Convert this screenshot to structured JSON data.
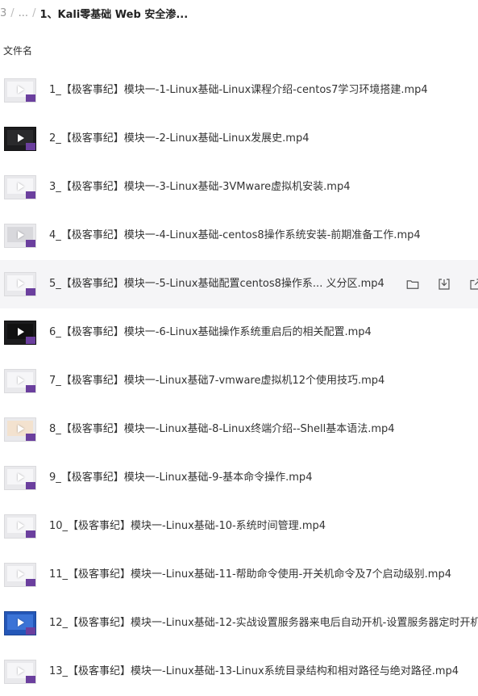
{
  "breadcrumb": {
    "prefix": "3",
    "ellipsis": "...",
    "current": "1、Kali零基础 Web 安全渗..."
  },
  "header": {
    "column_label": "文件名"
  },
  "files": [
    {
      "name": "1_【极客事纪】模块一-1-Linux基础-Linux课程介绍-centos7学习环境搭建.mp4",
      "thumb": "light"
    },
    {
      "name": "2_【极客事纪】模块一-2-Linux基础-Linux发展史.mp4",
      "thumb": "dark"
    },
    {
      "name": "3_【极客事纪】模块一-3-Linux基础-3VMware虚拟机安装.mp4",
      "thumb": "light"
    },
    {
      "name": "4_【极客事纪】模块一-4-Linux基础-centos8操作系统安装-前期准备工作.mp4",
      "thumb": "light"
    },
    {
      "name": "5_【极客事纪】模块一-5-Linux基础配置centos8操作系...  义分区.mp4",
      "thumb": "light",
      "hover": true
    },
    {
      "name": "6_【极客事纪】模块一-6-Linux基础操作系统重启后的相关配置.mp4",
      "thumb": "dark"
    },
    {
      "name": "7_【极客事纪】模块一-Linux基础7-vmware虚拟机12个使用技巧.mp4",
      "thumb": "light"
    },
    {
      "name": "8_【极客事纪】模块一-Linux基础-8-Linux终端介绍--Shell基本语法.mp4",
      "thumb": "light"
    },
    {
      "name": "9_【极客事纪】模块一-Linux基础-9-基本命令操作.mp4",
      "thumb": "light"
    },
    {
      "name": "10_【极客事纪】模块一-Linux基础-10-系统时间管理.mp4",
      "thumb": "light"
    },
    {
      "name": "11_【极客事纪】模块一-Linux基础-11-帮助命令使用-开关机命令及7个启动级别.mp4",
      "thumb": "light"
    },
    {
      "name": "12_【极客事纪】模块一-Linux基础-12-实战设置服务器来电后自动开机-设置服务器定时开机",
      "thumb": "blue"
    },
    {
      "name": "13_【极客事纪】模块一-Linux基础-13-Linux系统目录结构和相对路径与绝对路径.mp4",
      "thumb": "light"
    }
  ],
  "row_actions": {
    "open_folder": "folder-icon",
    "download": "download-icon",
    "share": "share-icon"
  }
}
